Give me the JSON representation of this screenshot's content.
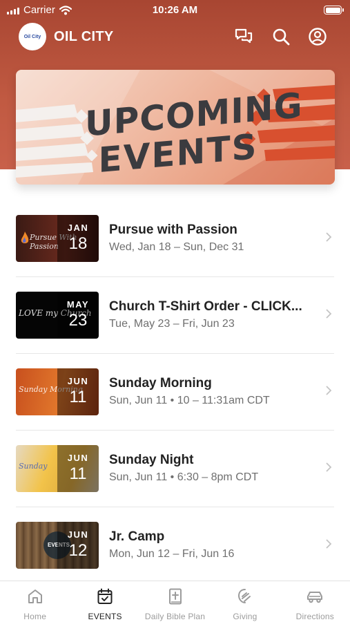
{
  "status_bar": {
    "carrier": "Carrier",
    "time": "10:26 AM"
  },
  "app": {
    "title": "OIL CITY",
    "logo_text": "Oil City",
    "brand_color": "#b9503a"
  },
  "header_icons": [
    "chat-icon",
    "search-icon",
    "profile-icon"
  ],
  "banner": {
    "line1": "UPCOMING",
    "line2": "EVENTS"
  },
  "events": [
    {
      "title": "Pursue with Passion",
      "subtitle": "Wed, Jan 18 – Sun, Dec 31",
      "month": "JAN",
      "day": "18",
      "thumb_text": "Pursue With Passion"
    },
    {
      "title": "Church T-Shirt Order - CLICK...",
      "subtitle": "Tue, May 23 – Fri, Jun 23",
      "month": "MAY",
      "day": "23",
      "thumb_text": "LOVE my Church"
    },
    {
      "title": "Sunday Morning",
      "subtitle": "Sun, Jun 11 • 10 – 11:31am CDT",
      "month": "JUN",
      "day": "11",
      "thumb_text": "Sunday Morning"
    },
    {
      "title": "Sunday Night",
      "subtitle": "Sun, Jun 11 • 6:30 – 8pm CDT",
      "month": "JUN",
      "day": "11",
      "thumb_text": "Sunday"
    },
    {
      "title": "Jr. Camp",
      "subtitle": "Mon, Jun 12 – Fri, Jun 16",
      "month": "JUN",
      "day": "12",
      "thumb_text": "EVENTS"
    }
  ],
  "tabs": [
    {
      "label": "Home",
      "icon": "home-icon",
      "active": false
    },
    {
      "label": "EVENTS",
      "icon": "calendar-icon",
      "active": true
    },
    {
      "label": "Daily Bible Plan",
      "icon": "bible-icon",
      "active": false
    },
    {
      "label": "Giving",
      "icon": "giving-icon",
      "active": false
    },
    {
      "label": "Directions",
      "icon": "car-icon",
      "active": false
    }
  ]
}
